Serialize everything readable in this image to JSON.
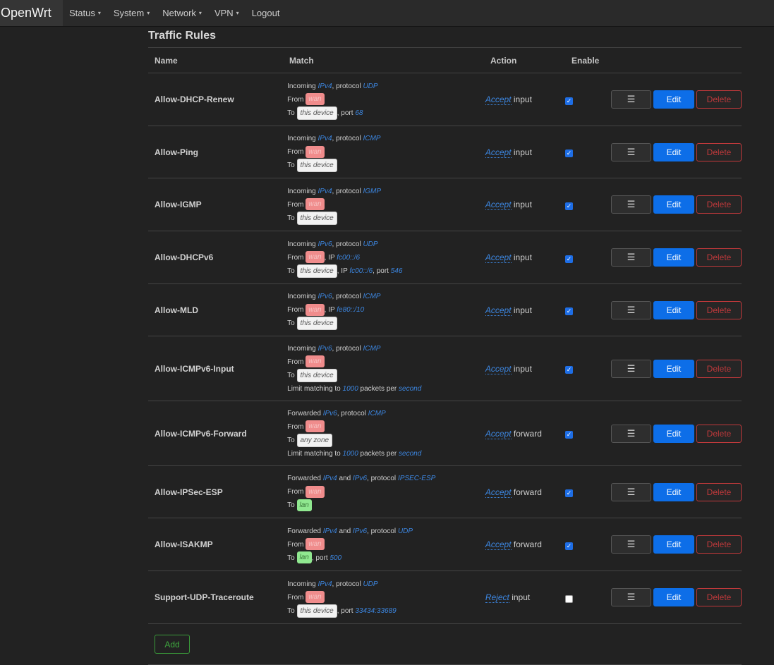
{
  "brand": "OpenWrt",
  "nav": [
    {
      "label": "Status",
      "dropdown": true
    },
    {
      "label": "System",
      "dropdown": true
    },
    {
      "label": "Network",
      "dropdown": true
    },
    {
      "label": "VPN",
      "dropdown": true
    },
    {
      "label": "Logout",
      "dropdown": false
    }
  ],
  "section_title": "Traffic Rules",
  "headers": {
    "name": "Name",
    "match": "Match",
    "action": "Action",
    "enable": "Enable"
  },
  "buttons": {
    "menu": "☰",
    "edit": "Edit",
    "delete": "Delete",
    "add": "Add"
  },
  "colors": {
    "zone_wan": "#f08c8c",
    "zone_lan": "#90e890",
    "zone_device": "#f2f2f2",
    "accent": "#0d6ee8",
    "delete": "#c0393b"
  },
  "rules": [
    {
      "name": "Allow-DHCP-Renew",
      "enabled": true,
      "action": "Accept",
      "target": "input",
      "match": [
        [
          {
            "t": "Incoming "
          },
          {
            "i": "IPv4"
          },
          {
            "t": ", protocol "
          },
          {
            "i": "UDP"
          }
        ],
        [
          {
            "t": "From "
          },
          {
            "z": "wan",
            "c": "wan"
          }
        ],
        [
          {
            "t": "To "
          },
          {
            "z": "this device",
            "c": "dev"
          },
          {
            "t": ", port "
          },
          {
            "i": "68"
          }
        ]
      ]
    },
    {
      "name": "Allow-Ping",
      "enabled": true,
      "action": "Accept",
      "target": "input",
      "match": [
        [
          {
            "t": "Incoming "
          },
          {
            "i": "IPv4"
          },
          {
            "t": ", protocol "
          },
          {
            "i": "ICMP"
          }
        ],
        [
          {
            "t": "From "
          },
          {
            "z": "wan",
            "c": "wan"
          }
        ],
        [
          {
            "t": "To "
          },
          {
            "z": "this device",
            "c": "dev"
          }
        ]
      ]
    },
    {
      "name": "Allow-IGMP",
      "enabled": true,
      "action": "Accept",
      "target": "input",
      "match": [
        [
          {
            "t": "Incoming "
          },
          {
            "i": "IPv4"
          },
          {
            "t": ", protocol "
          },
          {
            "i": "IGMP"
          }
        ],
        [
          {
            "t": "From "
          },
          {
            "z": "wan",
            "c": "wan"
          }
        ],
        [
          {
            "t": "To "
          },
          {
            "z": "this device",
            "c": "dev"
          }
        ]
      ]
    },
    {
      "name": "Allow-DHCPv6",
      "enabled": true,
      "action": "Accept",
      "target": "input",
      "match": [
        [
          {
            "t": "Incoming "
          },
          {
            "i": "IPv6"
          },
          {
            "t": ", protocol "
          },
          {
            "i": "UDP"
          }
        ],
        [
          {
            "t": "From "
          },
          {
            "z": "wan",
            "c": "wan"
          },
          {
            "t": ", IP "
          },
          {
            "i": "fc00::/6"
          }
        ],
        [
          {
            "t": "To "
          },
          {
            "z": "this device",
            "c": "dev"
          },
          {
            "t": ", IP "
          },
          {
            "i": "fc00::/6"
          },
          {
            "t": ", port "
          },
          {
            "i": "546"
          }
        ]
      ]
    },
    {
      "name": "Allow-MLD",
      "enabled": true,
      "action": "Accept",
      "target": "input",
      "match": [
        [
          {
            "t": "Incoming "
          },
          {
            "i": "IPv6"
          },
          {
            "t": ", protocol "
          },
          {
            "i": "ICMP"
          }
        ],
        [
          {
            "t": "From "
          },
          {
            "z": "wan",
            "c": "wan"
          },
          {
            "t": ", IP "
          },
          {
            "i": "fe80::/10"
          }
        ],
        [
          {
            "t": "To "
          },
          {
            "z": "this device",
            "c": "dev"
          }
        ]
      ]
    },
    {
      "name": "Allow-ICMPv6-Input",
      "enabled": true,
      "action": "Accept",
      "target": "input",
      "match": [
        [
          {
            "t": "Incoming "
          },
          {
            "i": "IPv6"
          },
          {
            "t": ", protocol "
          },
          {
            "i": "ICMP"
          }
        ],
        [
          {
            "t": "From "
          },
          {
            "z": "wan",
            "c": "wan"
          }
        ],
        [
          {
            "t": "To "
          },
          {
            "z": "this device",
            "c": "dev"
          }
        ],
        [
          {
            "t": "Limit matching to "
          },
          {
            "i": "1000"
          },
          {
            "t": " packets per "
          },
          {
            "i": "second"
          }
        ]
      ]
    },
    {
      "name": "Allow-ICMPv6-Forward",
      "enabled": true,
      "action": "Accept",
      "target": "forward",
      "match": [
        [
          {
            "t": "Forwarded "
          },
          {
            "i": "IPv6"
          },
          {
            "t": ", protocol "
          },
          {
            "i": "ICMP"
          }
        ],
        [
          {
            "t": "From "
          },
          {
            "z": "wan",
            "c": "wan"
          }
        ],
        [
          {
            "t": "To "
          },
          {
            "z": "any zone",
            "c": "dev"
          }
        ],
        [
          {
            "t": "Limit matching to "
          },
          {
            "i": "1000"
          },
          {
            "t": " packets per "
          },
          {
            "i": "second"
          }
        ]
      ]
    },
    {
      "name": "Allow-IPSec-ESP",
      "enabled": true,
      "action": "Accept",
      "target": "forward",
      "match": [
        [
          {
            "t": "Forwarded "
          },
          {
            "i": "IPv4"
          },
          {
            "t": " and "
          },
          {
            "i": "IPv6"
          },
          {
            "t": ", protocol "
          },
          {
            "i": "IPSEC-ESP"
          }
        ],
        [
          {
            "t": "From "
          },
          {
            "z": "wan",
            "c": "wan"
          }
        ],
        [
          {
            "t": "To "
          },
          {
            "z": "lan",
            "c": "lan"
          }
        ]
      ]
    },
    {
      "name": "Allow-ISAKMP",
      "enabled": true,
      "action": "Accept",
      "target": "forward",
      "match": [
        [
          {
            "t": "Forwarded "
          },
          {
            "i": "IPv4"
          },
          {
            "t": " and "
          },
          {
            "i": "IPv6"
          },
          {
            "t": ", protocol "
          },
          {
            "i": "UDP"
          }
        ],
        [
          {
            "t": "From "
          },
          {
            "z": "wan",
            "c": "wan"
          }
        ],
        [
          {
            "t": "To "
          },
          {
            "z": "lan",
            "c": "lan"
          },
          {
            "t": ", port "
          },
          {
            "i": "500"
          }
        ]
      ]
    },
    {
      "name": "Support-UDP-Traceroute",
      "enabled": false,
      "action": "Reject",
      "target": "input",
      "match": [
        [
          {
            "t": "Incoming "
          },
          {
            "i": "IPv4"
          },
          {
            "t": ", protocol "
          },
          {
            "i": "UDP"
          }
        ],
        [
          {
            "t": "From "
          },
          {
            "z": "wan",
            "c": "wan"
          }
        ],
        [
          {
            "t": "To "
          },
          {
            "z": "this device",
            "c": "dev"
          },
          {
            "t": ", port "
          },
          {
            "i": "33434:33689"
          }
        ]
      ]
    }
  ]
}
